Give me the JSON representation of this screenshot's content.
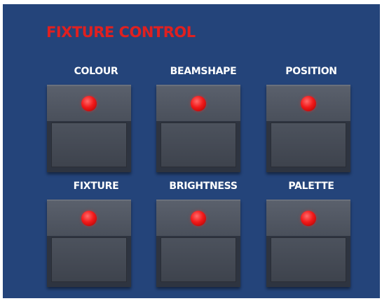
{
  "panel": {
    "title": "FIXTURE CONTROL"
  },
  "buttons": [
    {
      "label": "COLOUR",
      "led": "on",
      "led_color": "#e81c1c"
    },
    {
      "label": "BEAMSHAPE",
      "led": "on",
      "led_color": "#e81c1c"
    },
    {
      "label": "POSITION",
      "led": "on",
      "led_color": "#e81c1c"
    },
    {
      "label": "FIXTURE",
      "led": "on",
      "led_color": "#e81c1c"
    },
    {
      "label": "BRIGHTNESS",
      "led": "on",
      "led_color": "#e81c1c"
    },
    {
      "label": "PALETTE",
      "led": "on",
      "led_color": "#e81c1c"
    }
  ],
  "colors": {
    "panel_background": "#24447a",
    "title": "#e02020",
    "label": "#ffffff"
  }
}
